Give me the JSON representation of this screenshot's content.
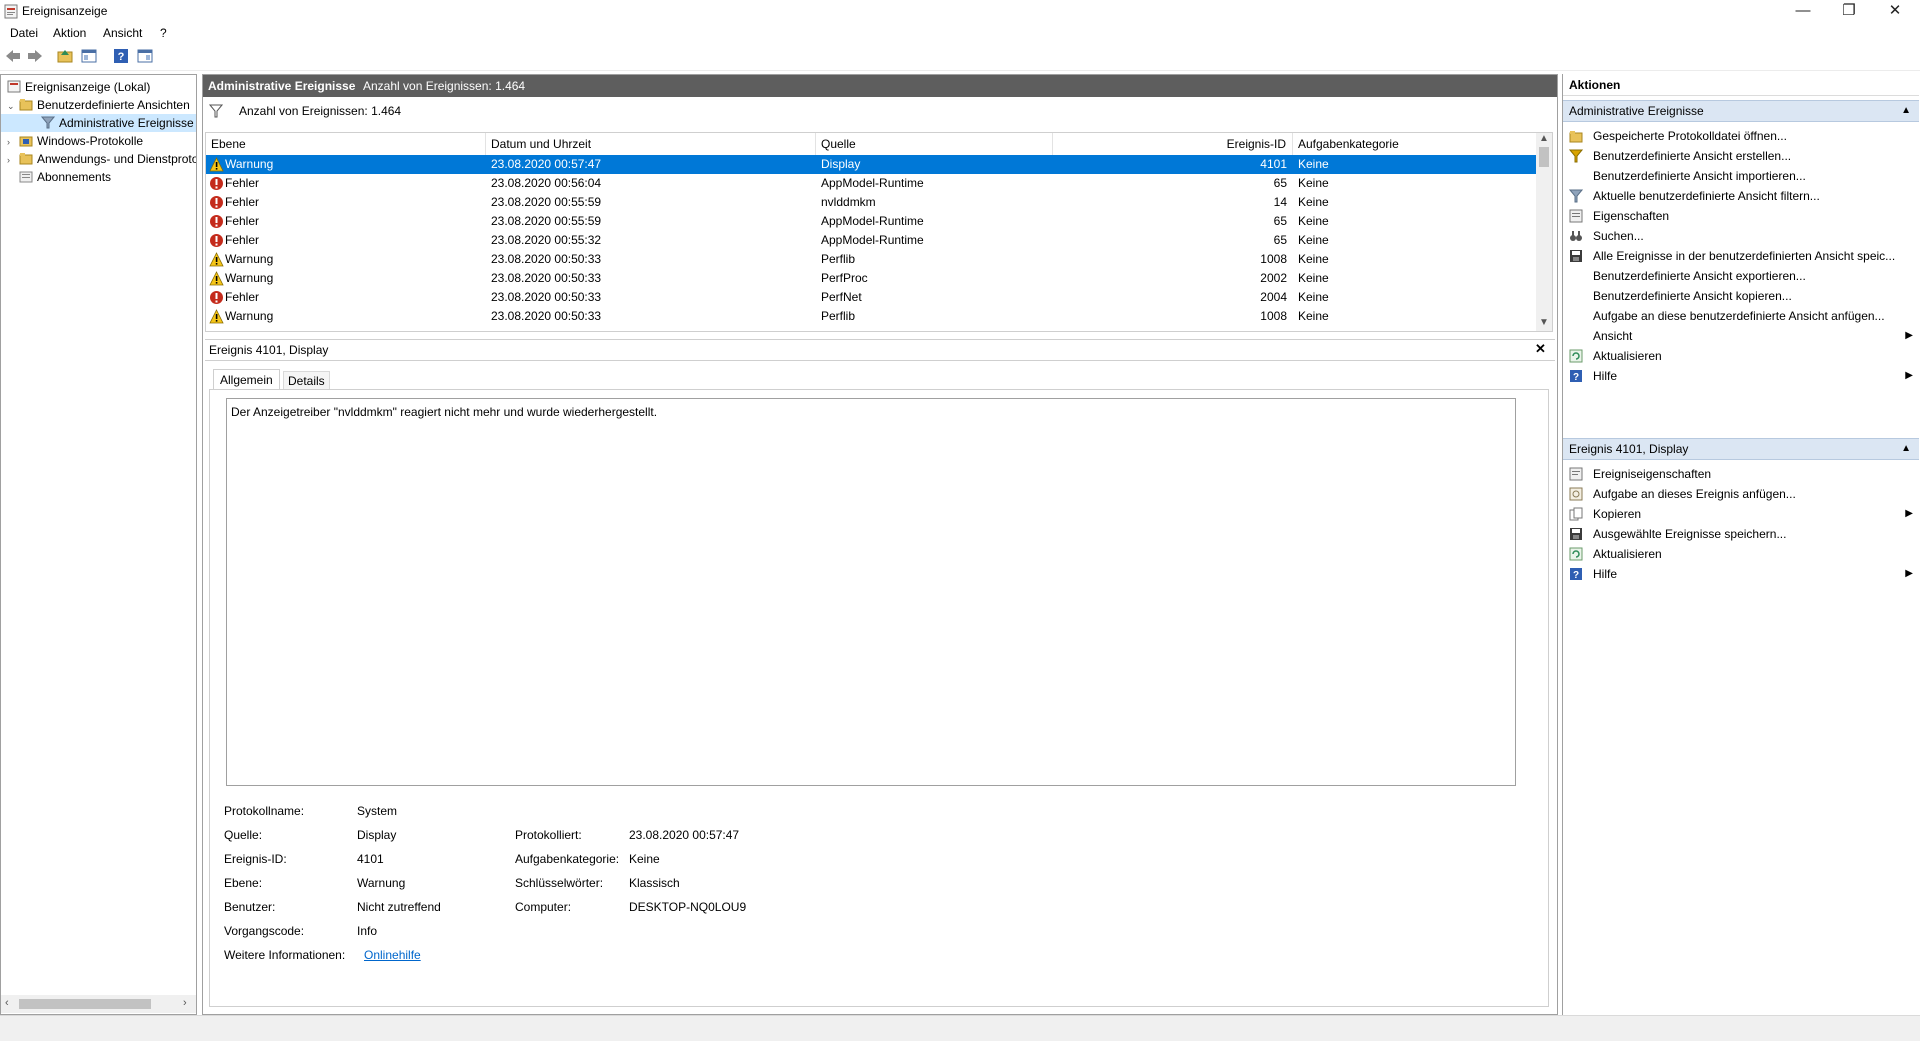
{
  "window": {
    "title": "Ereignisanzeige",
    "minimize": "—",
    "maximize": "❐",
    "close": "✕"
  },
  "menu": [
    "Datei",
    "Aktion",
    "Ansicht",
    "?"
  ],
  "tree": {
    "root": "Ereignisanzeige (Lokal)",
    "custom_views": "Benutzerdefinierte Ansichten",
    "admin_events": "Administrative Ereignisse",
    "windows_logs": "Windows-Protokolle",
    "app_logs": "Anwendungs- und Dienstprotokolle",
    "subscriptions": "Abonnements"
  },
  "center": {
    "header_title": "Administrative Ereignisse",
    "header_count": "Anzahl von Ereignissen: 1.464",
    "filter_text": "Anzahl von Ereignissen: 1.464",
    "columns": [
      "Ebene",
      "Datum und Uhrzeit",
      "Quelle",
      "Ereignis-ID",
      "Aufgabenkategorie"
    ],
    "rows": [
      {
        "level": "Warnung",
        "type": "warning",
        "date": "23.08.2020 00:57:47",
        "source": "Display",
        "id": "4101",
        "task": "Keine"
      },
      {
        "level": "Fehler",
        "type": "error",
        "date": "23.08.2020 00:56:04",
        "source": "AppModel-Runtime",
        "id": "65",
        "task": "Keine"
      },
      {
        "level": "Fehler",
        "type": "error",
        "date": "23.08.2020 00:55:59",
        "source": "nvlddmkm",
        "id": "14",
        "task": "Keine"
      },
      {
        "level": "Fehler",
        "type": "error",
        "date": "23.08.2020 00:55:59",
        "source": "AppModel-Runtime",
        "id": "65",
        "task": "Keine"
      },
      {
        "level": "Fehler",
        "type": "error",
        "date": "23.08.2020 00:55:32",
        "source": "AppModel-Runtime",
        "id": "65",
        "task": "Keine"
      },
      {
        "level": "Warnung",
        "type": "warning",
        "date": "23.08.2020 00:50:33",
        "source": "Perflib",
        "id": "1008",
        "task": "Keine"
      },
      {
        "level": "Warnung",
        "type": "warning",
        "date": "23.08.2020 00:50:33",
        "source": "PerfProc",
        "id": "2002",
        "task": "Keine"
      },
      {
        "level": "Fehler",
        "type": "error",
        "date": "23.08.2020 00:50:33",
        "source": "PerfNet",
        "id": "2004",
        "task": "Keine"
      },
      {
        "level": "Warnung",
        "type": "warning",
        "date": "23.08.2020 00:50:33",
        "source": "Perflib",
        "id": "1008",
        "task": "Keine"
      }
    ]
  },
  "detail": {
    "title": "Ereignis 4101, Display",
    "tabs": [
      "Allgemein",
      "Details"
    ],
    "message": "Der Anzeigetreiber \"nvlddmkm\" reagiert nicht mehr und wurde wiederhergestellt.",
    "fields": {
      "log_name_label": "Protokollname:",
      "log_name": "System",
      "source_label": "Quelle:",
      "source": "Display",
      "logged_label": "Protokolliert:",
      "logged": "23.08.2020 00:57:47",
      "event_id_label": "Ereignis-ID:",
      "event_id": "4101",
      "task_label": "Aufgabenkategorie:",
      "task": "Keine",
      "level_label": "Ebene:",
      "level": "Warnung",
      "keywords_label": "Schlüsselwörter:",
      "keywords": "Klassisch",
      "user_label": "Benutzer:",
      "user": "Nicht zutreffend",
      "computer_label": "Computer:",
      "computer": "DESKTOP-NQ0LOU9",
      "opcode_label": "Vorgangscode:",
      "opcode": "Info",
      "more_info_label": "Weitere Informationen:",
      "more_info": "Onlinehilfe"
    }
  },
  "actions": {
    "title": "Aktionen",
    "section1": "Administrative Ereignisse",
    "items1": [
      {
        "label": "Gespeicherte Protokolldatei öffnen...",
        "icon": "folder-open-icon",
        "arrow": false
      },
      {
        "label": "Benutzerdefinierte Ansicht erstellen...",
        "icon": "filter-create-icon",
        "arrow": false
      },
      {
        "label": "Benutzerdefinierte Ansicht importieren...",
        "icon": "none",
        "arrow": false
      },
      {
        "label": "Aktuelle benutzerdefinierte Ansicht filtern...",
        "icon": "filter-icon",
        "arrow": false
      },
      {
        "label": "Eigenschaften",
        "icon": "properties-icon",
        "arrow": false
      },
      {
        "label": "Suchen...",
        "icon": "binoculars-icon",
        "arrow": false
      },
      {
        "label": "Alle Ereignisse in der benutzerdefinierten Ansicht speic...",
        "icon": "save-icon",
        "arrow": false
      },
      {
        "label": "Benutzerdefinierte Ansicht exportieren...",
        "icon": "none",
        "arrow": false
      },
      {
        "label": "Benutzerdefinierte Ansicht kopieren...",
        "icon": "none",
        "arrow": false
      },
      {
        "label": "Aufgabe an diese benutzerdefinierte Ansicht anfügen...",
        "icon": "none",
        "arrow": false
      },
      {
        "label": "Ansicht",
        "icon": "none",
        "arrow": true
      },
      {
        "label": "Aktualisieren",
        "icon": "refresh-icon",
        "arrow": false
      },
      {
        "label": "Hilfe",
        "icon": "help-icon",
        "arrow": true
      }
    ],
    "section2": "Ereignis 4101, Display",
    "items2": [
      {
        "label": "Ereigniseigenschaften",
        "icon": "event-properties-icon",
        "arrow": false
      },
      {
        "label": "Aufgabe an dieses Ereignis anfügen...",
        "icon": "task-icon",
        "arrow": false
      },
      {
        "label": "Kopieren",
        "icon": "copy-icon",
        "arrow": true
      },
      {
        "label": "Ausgewählte Ereignisse speichern...",
        "icon": "save-icon",
        "arrow": false
      },
      {
        "label": "Aktualisieren",
        "icon": "refresh-icon",
        "arrow": false
      },
      {
        "label": "Hilfe",
        "icon": "help-icon",
        "arrow": true
      }
    ]
  },
  "colors": {
    "selection": "#0078d7",
    "header_dark": "#5e5e5e",
    "action_header": "#dbe6f3",
    "link": "#0066cc"
  }
}
